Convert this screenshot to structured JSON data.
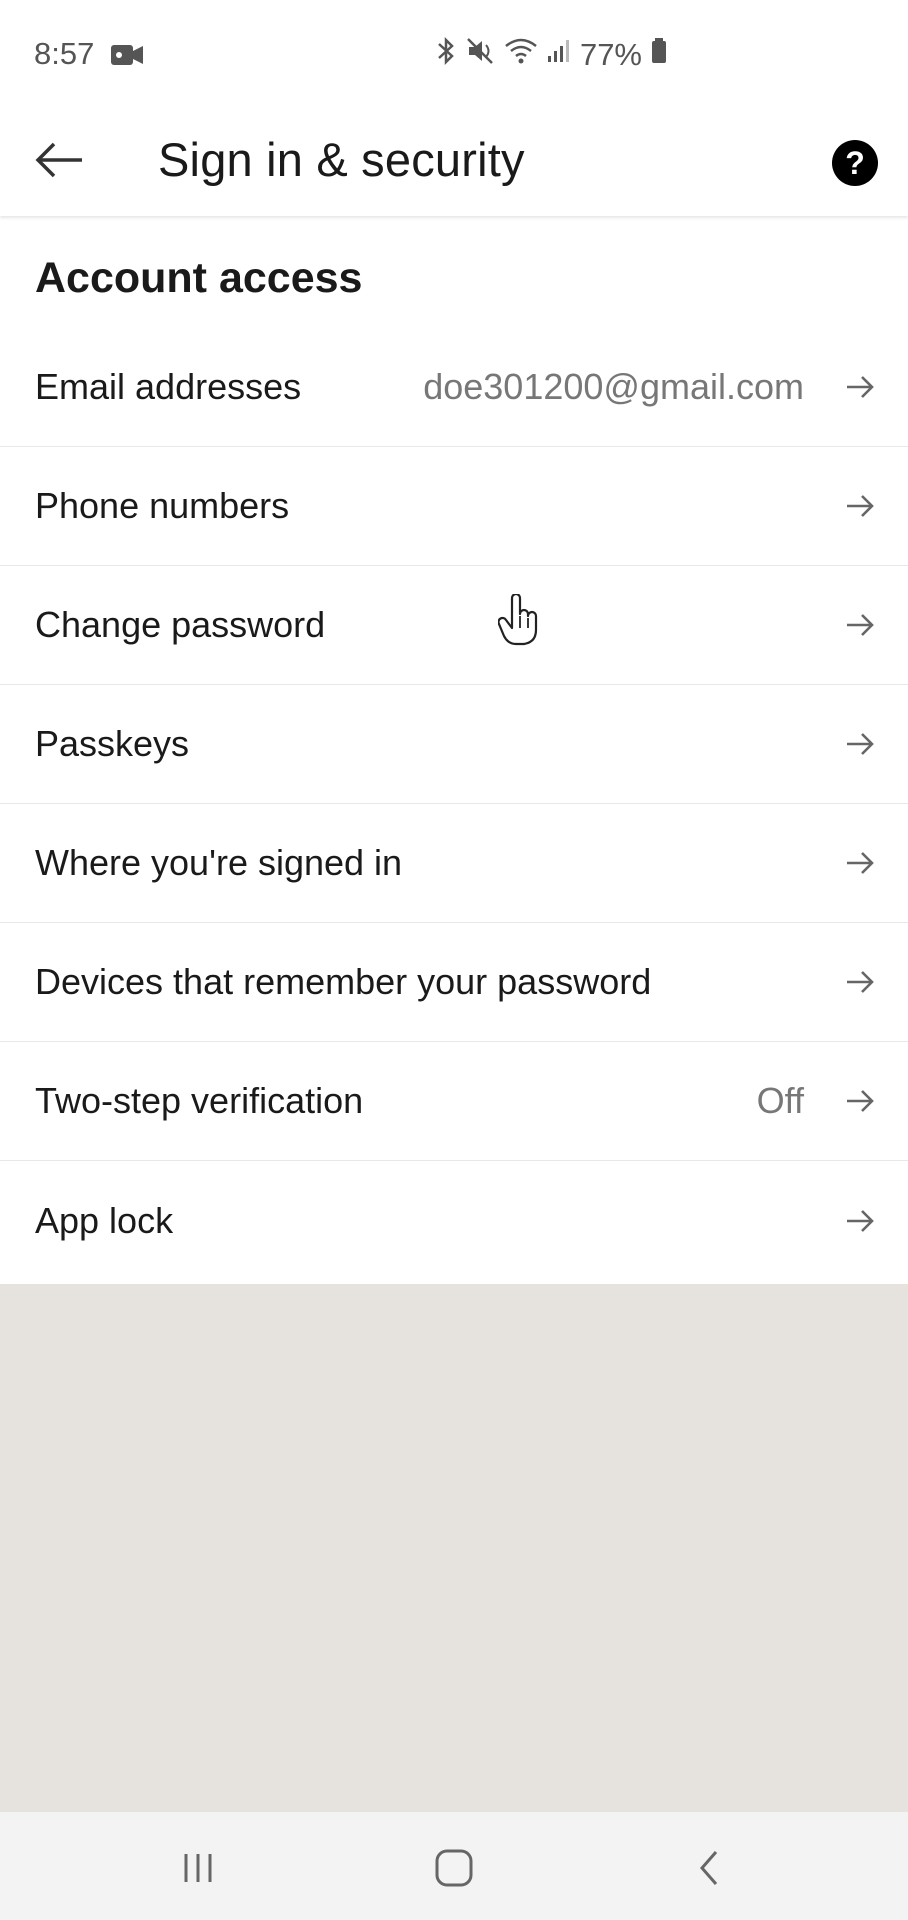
{
  "status_bar": {
    "time": "8:57",
    "battery": "77%",
    "icons": [
      "video-record-icon",
      "bluetooth-icon",
      "mute-icon",
      "wifi-icon",
      "signal-icon",
      "battery-icon"
    ]
  },
  "header": {
    "title": "Sign in & security",
    "back_icon": "arrow-left-icon",
    "help_label": "?"
  },
  "section": {
    "heading": "Account access"
  },
  "rows": [
    {
      "label": "Email addresses",
      "value": "doe301200@gmail.com"
    },
    {
      "label": "Phone numbers",
      "value": ""
    },
    {
      "label": "Change password",
      "value": ""
    },
    {
      "label": "Passkeys",
      "value": ""
    },
    {
      "label": "Where you're signed in",
      "value": ""
    },
    {
      "label": "Devices that remember your password",
      "value": ""
    },
    {
      "label": "Two-step verification",
      "value": "Off"
    },
    {
      "label": "App lock",
      "value": ""
    }
  ],
  "nav_bar": {
    "icons": [
      "recent-apps-icon",
      "home-icon",
      "back-icon"
    ]
  },
  "colors": {
    "background": "#e6e3df",
    "surface": "#ffffff",
    "text": "#1a1a1a",
    "secondary_text": "#777777"
  }
}
